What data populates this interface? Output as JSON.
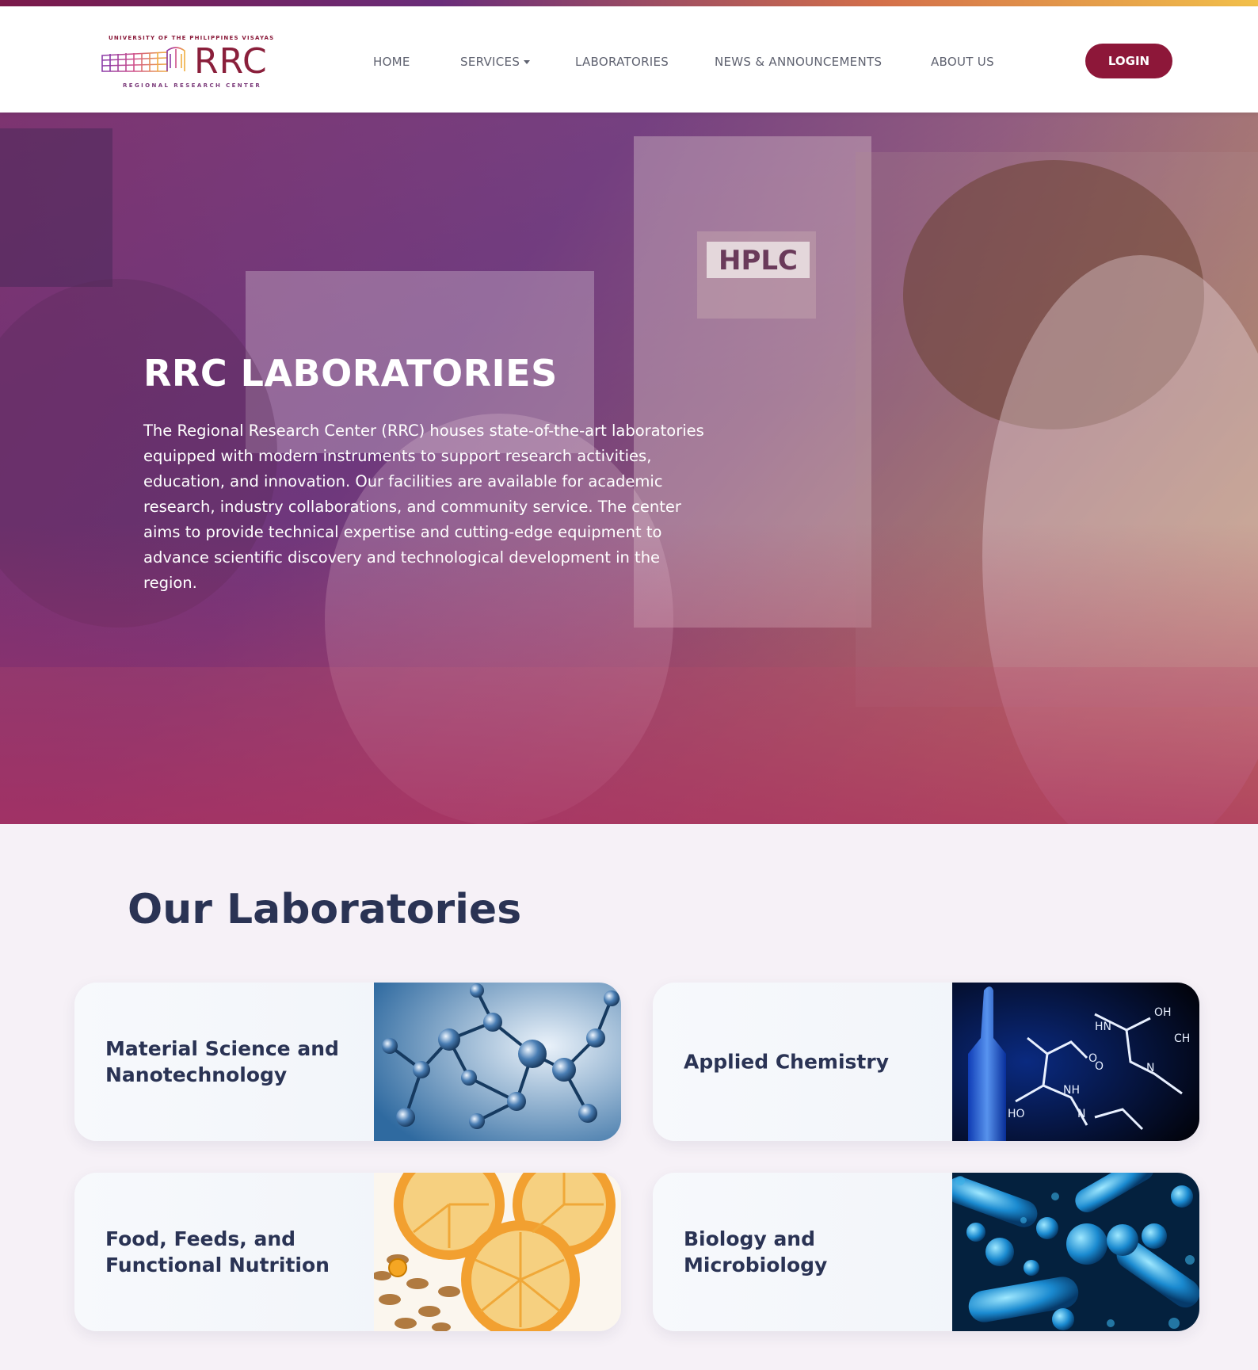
{
  "header": {
    "logo": {
      "top_text": "UNIVERSITY OF THE PHILIPPINES VISAYAS",
      "wordmark": "RRC",
      "bottom_text": "REGIONAL RESEARCH CENTER"
    },
    "nav": {
      "home": "HOME",
      "services": "SERVICES",
      "laboratories": "LABORATORIES",
      "news": "NEWS & ANNOUNCEMENTS",
      "about": "ABOUT US"
    },
    "login_label": "LOGIN"
  },
  "hero": {
    "title": "RRC LABORATORIES",
    "description": "The Regional Research Center (RRC) houses state-of-the-art laboratories equipped with modern instruments to support research activities, education, and innovation. Our facilities are available for academic research, industry collaborations, and community service. The center aims to provide technical expertise and cutting-edge equipment to advance scientific discovery and technological development in the region.",
    "equipment_label": "HPLC"
  },
  "labs_section": {
    "title": "Our Laboratories",
    "cards": [
      {
        "label": "Material Science and Nanotechnology",
        "image_icon": "molecule-structure-image"
      },
      {
        "label": "Applied Chemistry",
        "image_icon": "chemical-formula-image"
      },
      {
        "label": "Food, Feeds, and Functional Nutrition",
        "image_icon": "citrus-slices-image"
      },
      {
        "label": "Biology and Microbiology",
        "image_icon": "microbes-image"
      }
    ]
  },
  "colors": {
    "brand": "#8d1739",
    "heading": "#2a3354",
    "background": "#f6f1f7"
  }
}
